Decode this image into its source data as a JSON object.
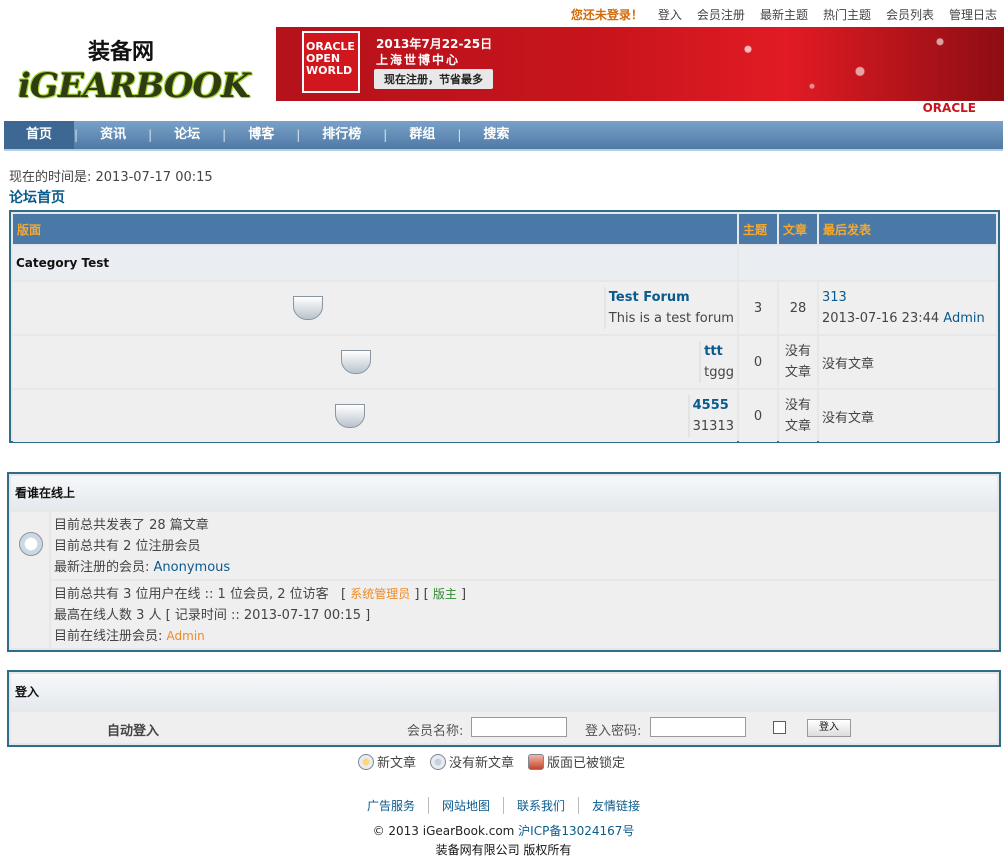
{
  "top_links": {
    "not_logged": "您还未登录！",
    "items": [
      "登入",
      "会员注册",
      "最新主题",
      "热门主题",
      "会员列表",
      "管理日志"
    ]
  },
  "logo": {
    "cn": "装备网",
    "en": "iGEARBOOK"
  },
  "banner": {
    "brand": "ORACLE OPEN WORLD",
    "date": "2013年7月22-25日",
    "place": "上海世博中心",
    "cta": "现在注册，节省最多",
    "oracle": "ORACLE"
  },
  "nav": {
    "items": [
      "首页",
      "资讯",
      "论坛",
      "博客",
      "排行榜",
      "群组",
      "搜索"
    ]
  },
  "time_line": "现在的时间是: 2013-07-17 00:15",
  "breadcrumb": "论坛首页",
  "forum_table": {
    "headers": [
      "版面",
      "主题",
      "文章",
      "最后发表"
    ],
    "category": "Category Test",
    "rows": [
      {
        "name": "Test Forum",
        "desc": "This is a test forum",
        "topics": "3",
        "posts": "28",
        "last_link": "313",
        "last_time": "2013-07-16 23:44",
        "last_user": "Admin"
      },
      {
        "name": "ttt",
        "desc": "tggg",
        "topics": "0",
        "posts": "没有文章",
        "last_text": "没有文章"
      },
      {
        "name": "4555",
        "desc": "31313",
        "topics": "0",
        "posts": "没有文章",
        "last_text": "没有文章"
      }
    ]
  },
  "online": {
    "title": "看谁在线上",
    "line1": "目前总共发表了 28 篇文章",
    "line2": "目前总共有 2 位注册会员",
    "line3_label": "最新注册的会员: ",
    "line3_user": "Anonymous",
    "line4_text": "目前总共有 3 位用户在线 :: 1 位会员, 2 位访客",
    "admin_label": "系统管理员",
    "mod_label": "版主",
    "line5": "最高在线人数 3 人 [ 记录时间 :: 2013-07-17 00:15 ]",
    "line6_label": "目前在线注册会员: ",
    "line6_user": "Admin"
  },
  "login": {
    "title": "登入",
    "auto": "自动登入",
    "user_label": "会员名称:",
    "pass_label": "登入密码:",
    "button": "登入"
  },
  "legend": {
    "new": "新文章",
    "none": "没有新文章",
    "locked": "版面已被锁定"
  },
  "footer": {
    "links": [
      "广告服务",
      "网站地图",
      "联系我们",
      "友情链接"
    ],
    "copyright": "© 2013 iGearBook.com ",
    "icp": "沪ICP备13024167号",
    "company": "装备网有限公司 版权所有"
  }
}
